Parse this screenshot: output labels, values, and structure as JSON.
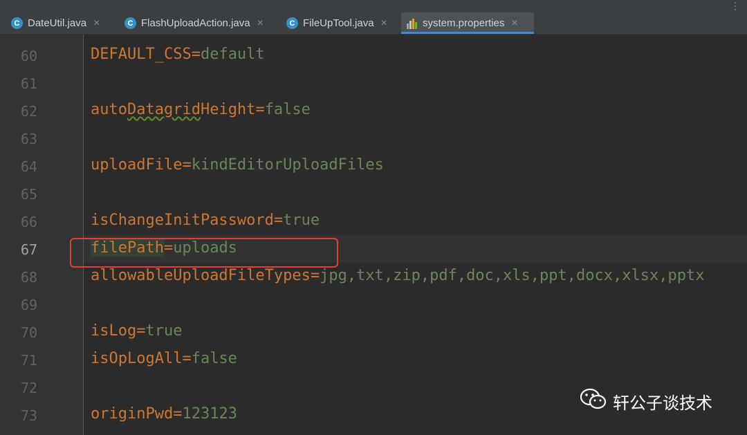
{
  "tabs": [
    {
      "label": "DateUtil.java",
      "icon": "java-class-icon",
      "active": false
    },
    {
      "label": "FlashUploadAction.java",
      "icon": "java-class-icon",
      "active": false
    },
    {
      "label": "FileUpTool.java",
      "icon": "java-class-icon",
      "active": false
    },
    {
      "label": "system.properties",
      "icon": "properties-file-icon",
      "active": true
    }
  ],
  "tab_icon_letter": "C",
  "close_glyph": "×",
  "more_glyph": "⋮",
  "lines": [
    {
      "no": "60",
      "key": "DEFAULT_CSS",
      "eq": "=",
      "value": "default"
    },
    {
      "no": "61",
      "key": "",
      "eq": "",
      "value": ""
    },
    {
      "no": "62",
      "key": "autoDatagridHeight",
      "eq": "=",
      "value": "false"
    },
    {
      "no": "63",
      "key": "",
      "eq": "",
      "value": ""
    },
    {
      "no": "64",
      "key": "uploadFile",
      "eq": "=",
      "value": "kindEditorUploadFiles"
    },
    {
      "no": "65",
      "key": "",
      "eq": "",
      "value": ""
    },
    {
      "no": "66",
      "key": "isChangeInitPassword",
      "eq": "=",
      "value": "true"
    },
    {
      "no": "67",
      "key": "filePath",
      "eq": "=",
      "value": "uploads"
    },
    {
      "no": "68",
      "key": "allowableUploadFileTypes",
      "eq": "=",
      "value": "jpg,txt,zip,pdf,doc,xls,ppt,docx,xlsx,pptx"
    },
    {
      "no": "69",
      "key": "",
      "eq": "",
      "value": ""
    },
    {
      "no": "70",
      "key": "isLog",
      "eq": "=",
      "value": "true"
    },
    {
      "no": "71",
      "key": "isOpLogAll",
      "eq": "=",
      "value": "false"
    },
    {
      "no": "72",
      "key": "",
      "eq": "",
      "value": ""
    },
    {
      "no": "73",
      "key": "originPwd",
      "eq": "=",
      "value": "123123"
    }
  ],
  "line62_parts": {
    "a": "auto",
    "b": "Datagrid",
    "c": "Height"
  },
  "current_line": "67",
  "watermark": "轩公子谈技术",
  "colors": {
    "key": "#cc7832",
    "value": "#6a8759",
    "highlight_box": "#e53e36",
    "tab_underline": "#4a88c7"
  }
}
